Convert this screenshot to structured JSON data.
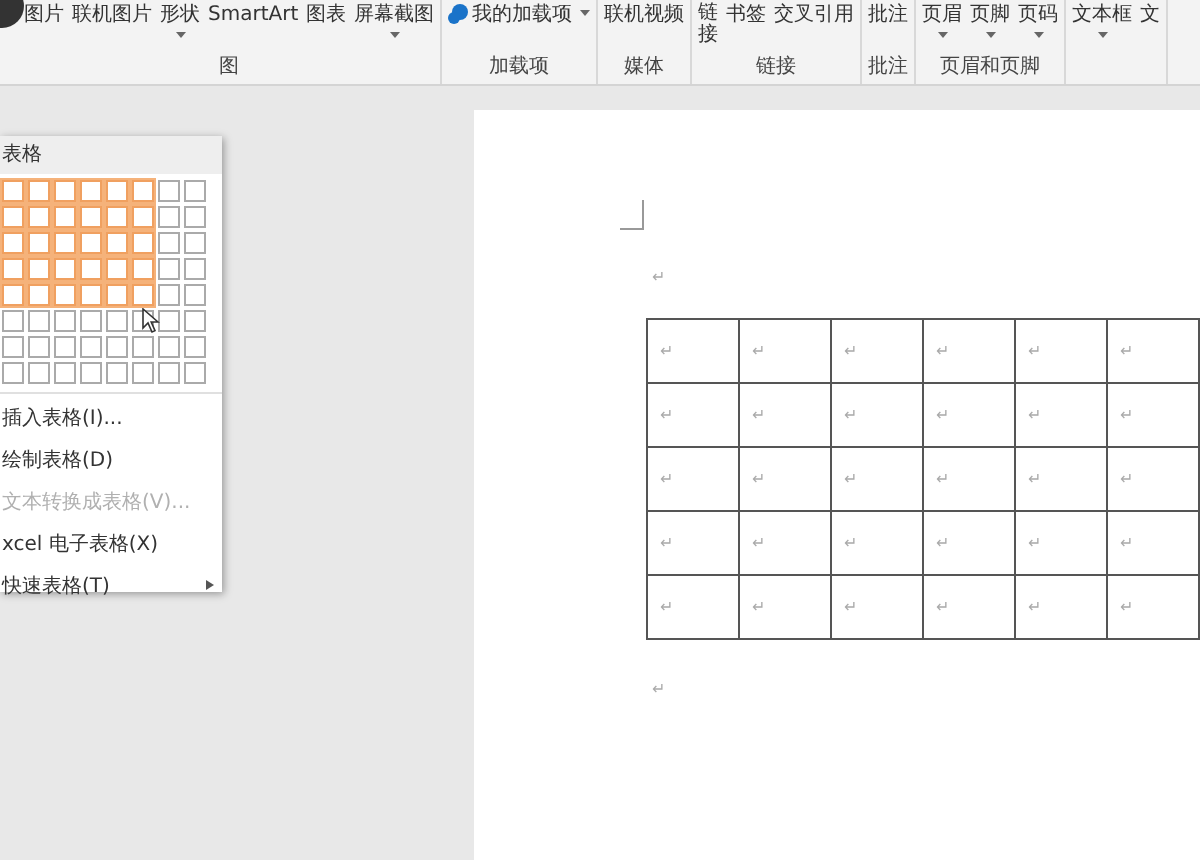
{
  "ribbon": {
    "groups": [
      {
        "label": "图",
        "buttons": [
          {
            "label": "图片",
            "dropdown": false
          },
          {
            "label": "联机图片",
            "dropdown": false
          },
          {
            "label": "形状",
            "dropdown": true
          },
          {
            "label": "SmartArt",
            "dropdown": false
          },
          {
            "label": "图表",
            "dropdown": false
          },
          {
            "label": "屏幕截图",
            "dropdown": true
          }
        ]
      },
      {
        "label": "加载项",
        "buttons": [
          {
            "label": "我的加载项",
            "dropdown": true
          }
        ]
      },
      {
        "label": "媒体",
        "buttons": [
          {
            "label": "联机视频",
            "dropdown": false
          }
        ]
      },
      {
        "label": "链接",
        "buttons": [
          {
            "label": "链接",
            "dropdown": false
          },
          {
            "label": "书签",
            "dropdown": false
          },
          {
            "label": "交叉引用",
            "dropdown": false
          }
        ]
      },
      {
        "label": "批注",
        "buttons": [
          {
            "label": "批注",
            "dropdown": false
          }
        ]
      },
      {
        "label": "页眉和页脚",
        "buttons": [
          {
            "label": "页眉",
            "dropdown": true
          },
          {
            "label": "页脚",
            "dropdown": true
          },
          {
            "label": "页码",
            "dropdown": true
          }
        ]
      },
      {
        "buttons": [
          {
            "label": "文本框",
            "dropdown": true
          },
          {
            "label": "文",
            "dropdown": false
          }
        ]
      }
    ]
  },
  "table_menu": {
    "title": "表格",
    "grid": [
      [
        true,
        true,
        true,
        true,
        true,
        true,
        false,
        false
      ],
      [
        true,
        true,
        true,
        true,
        true,
        true,
        false,
        false
      ],
      [
        true,
        true,
        true,
        true,
        true,
        true,
        false,
        false
      ],
      [
        true,
        true,
        true,
        true,
        true,
        true,
        false,
        false
      ],
      [
        true,
        true,
        true,
        true,
        true,
        true,
        false,
        false
      ],
      [
        false,
        false,
        false,
        false,
        false,
        false,
        false,
        false
      ],
      [
        false,
        false,
        false,
        false,
        false,
        false,
        false,
        false
      ],
      [
        false,
        false,
        false,
        false,
        false,
        false,
        false,
        false
      ]
    ],
    "items": [
      {
        "label": "插入表格(I)...",
        "disabled": false,
        "submenu": false
      },
      {
        "label": "绘制表格(D)",
        "disabled": false,
        "submenu": false
      },
      {
        "label": "文本转换成表格(V)...",
        "disabled": true,
        "submenu": false
      },
      {
        "label": "xcel 电子表格(X)",
        "disabled": false,
        "submenu": false
      },
      {
        "label": "快速表格(T)",
        "disabled": false,
        "submenu": true
      }
    ]
  },
  "document": {
    "before_mark": "↵",
    "after_mark": "↵",
    "table": [
      [
        "↵",
        "↵",
        "↵",
        "↵",
        "↵",
        "↵"
      ],
      [
        "↵",
        "↵",
        "↵",
        "↵",
        "↵",
        "↵"
      ],
      [
        "↵",
        "↵",
        "↵",
        "↵",
        "↵",
        "↵"
      ],
      [
        "↵",
        "↵",
        "↵",
        "↵",
        "↵",
        "↵"
      ],
      [
        "↵",
        "↵",
        "↵",
        "↵",
        "↵",
        "↵"
      ]
    ]
  }
}
